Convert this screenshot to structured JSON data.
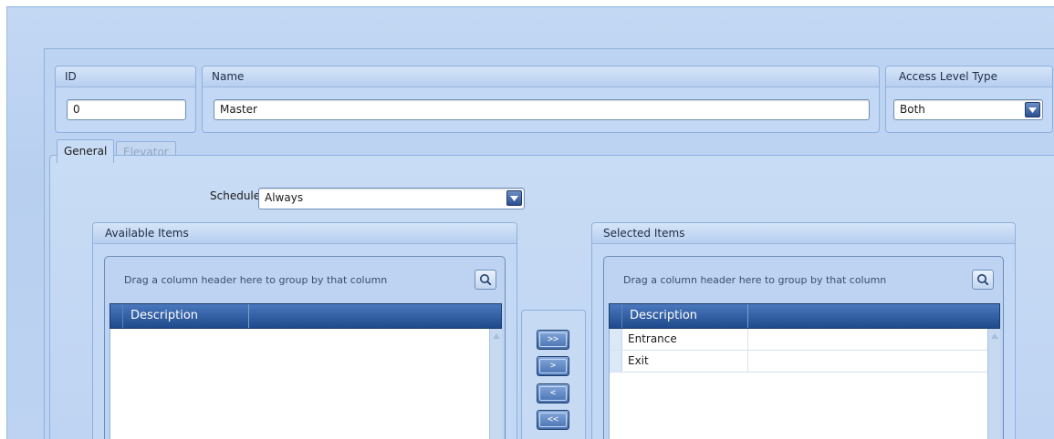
{
  "header": {
    "id": {
      "label": "ID",
      "value": "0"
    },
    "name": {
      "label": "Name",
      "value": "Master"
    },
    "access_level_type": {
      "label": "Access Level Type",
      "value": "Both"
    }
  },
  "tabs": [
    {
      "label": "General",
      "active": true
    },
    {
      "label": "Elevator",
      "active": false
    }
  ],
  "general": {
    "schedule": {
      "label": "Schedule",
      "value": "Always"
    },
    "available": {
      "title": "Available Items",
      "drag_hint": "Drag a column header here to group by that column",
      "columns": [
        "Description"
      ],
      "rows": []
    },
    "selected": {
      "title": "Selected Items",
      "drag_hint": "Drag a column header here to group by that column",
      "columns": [
        "Description"
      ],
      "rows": [
        {
          "description": "Entrance"
        },
        {
          "description": "Exit"
        }
      ]
    },
    "move_buttons": {
      "add_all": ">>",
      "add": ">",
      "remove": "<",
      "remove_all": "<<"
    }
  },
  "icons": {
    "combo": "chevron-down-icon",
    "search": "magnifier-icon",
    "scroll": "scroll-up-arrow-icon"
  },
  "colors": {
    "grid_header": "#2b5699",
    "background": "#bdd3f1"
  }
}
